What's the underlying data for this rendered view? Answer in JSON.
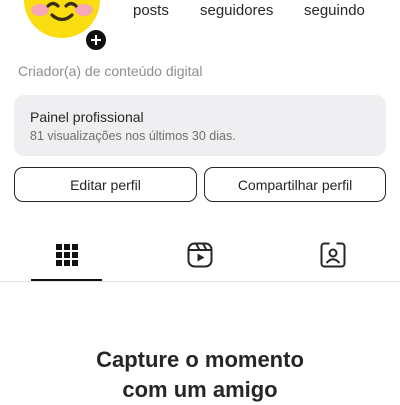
{
  "profile": {
    "stats": {
      "posts_label": "posts",
      "followers_label": "seguidores",
      "following_label": "seguindo"
    },
    "category": "Criador(a) de conteúdo digital"
  },
  "dashboard": {
    "title": "Painel profissional",
    "subtitle": "81 visualizações nos últimos 30 dias."
  },
  "actions": {
    "edit_label": "Editar perfil",
    "share_label": "Compartilhar perfil"
  },
  "tabs": [
    {
      "icon": "grid-icon",
      "active": true
    },
    {
      "icon": "reels-icon",
      "active": false
    },
    {
      "icon": "tagged-icon",
      "active": false
    }
  ],
  "empty_state": {
    "line1": "Capture o momento",
    "line2": "com um amigo"
  },
  "colors": {
    "avatar": "#f9dd10",
    "text": "#262626",
    "muted": "#8e8e8e",
    "panel": "#efeff1"
  }
}
